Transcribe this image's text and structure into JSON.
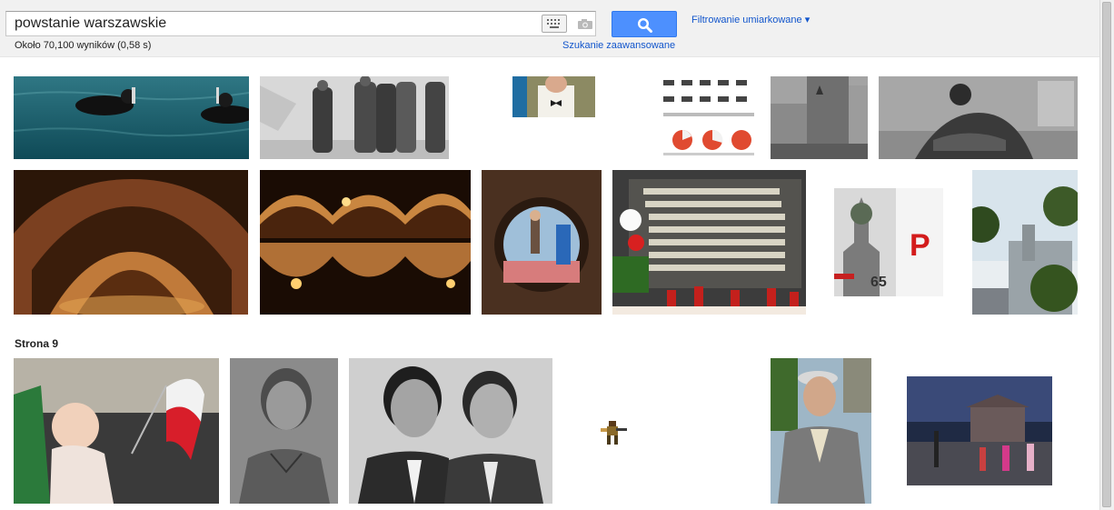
{
  "search": {
    "query": "powstanie warszawskie",
    "keyboard_icon": "keyboard-icon",
    "camera_icon": "camera-icon",
    "button_icon": "magnifier-icon",
    "safe_search_label": "Filtrowanie umiarkowane ▾",
    "advanced_label": "Szukanie zaawansowane"
  },
  "results": {
    "stats": "Około 70,100 wyników (0,58 s)",
    "page_label": "Strona 9"
  },
  "colors": {
    "accent": "#4d90fe",
    "link": "#1155cc",
    "header_bg": "#f1f1f1"
  },
  "thumbnails": [
    "divers-in-water-image",
    "soldiers-in-coats-bw-image",
    "man-with-bowtie-image",
    "infographic-pie-charts-image",
    "street-memorial-bw-image",
    "wounded-man-bw-image",
    "brick-vault-arches-image",
    "brick-cistern-reflection-image",
    "round-porthole-view-image",
    "memorial-plaque-with-candles-image",
    "anniversary-poster-65-image",
    "trees-and-building-image",
    "baby-with-polish-flag-image",
    "young-man-portrait-bw-image",
    "two-men-portrait-bw-image",
    "small-animated-soldier-image",
    "elderly-man-in-cap-image",
    "evening-town-square-image"
  ]
}
